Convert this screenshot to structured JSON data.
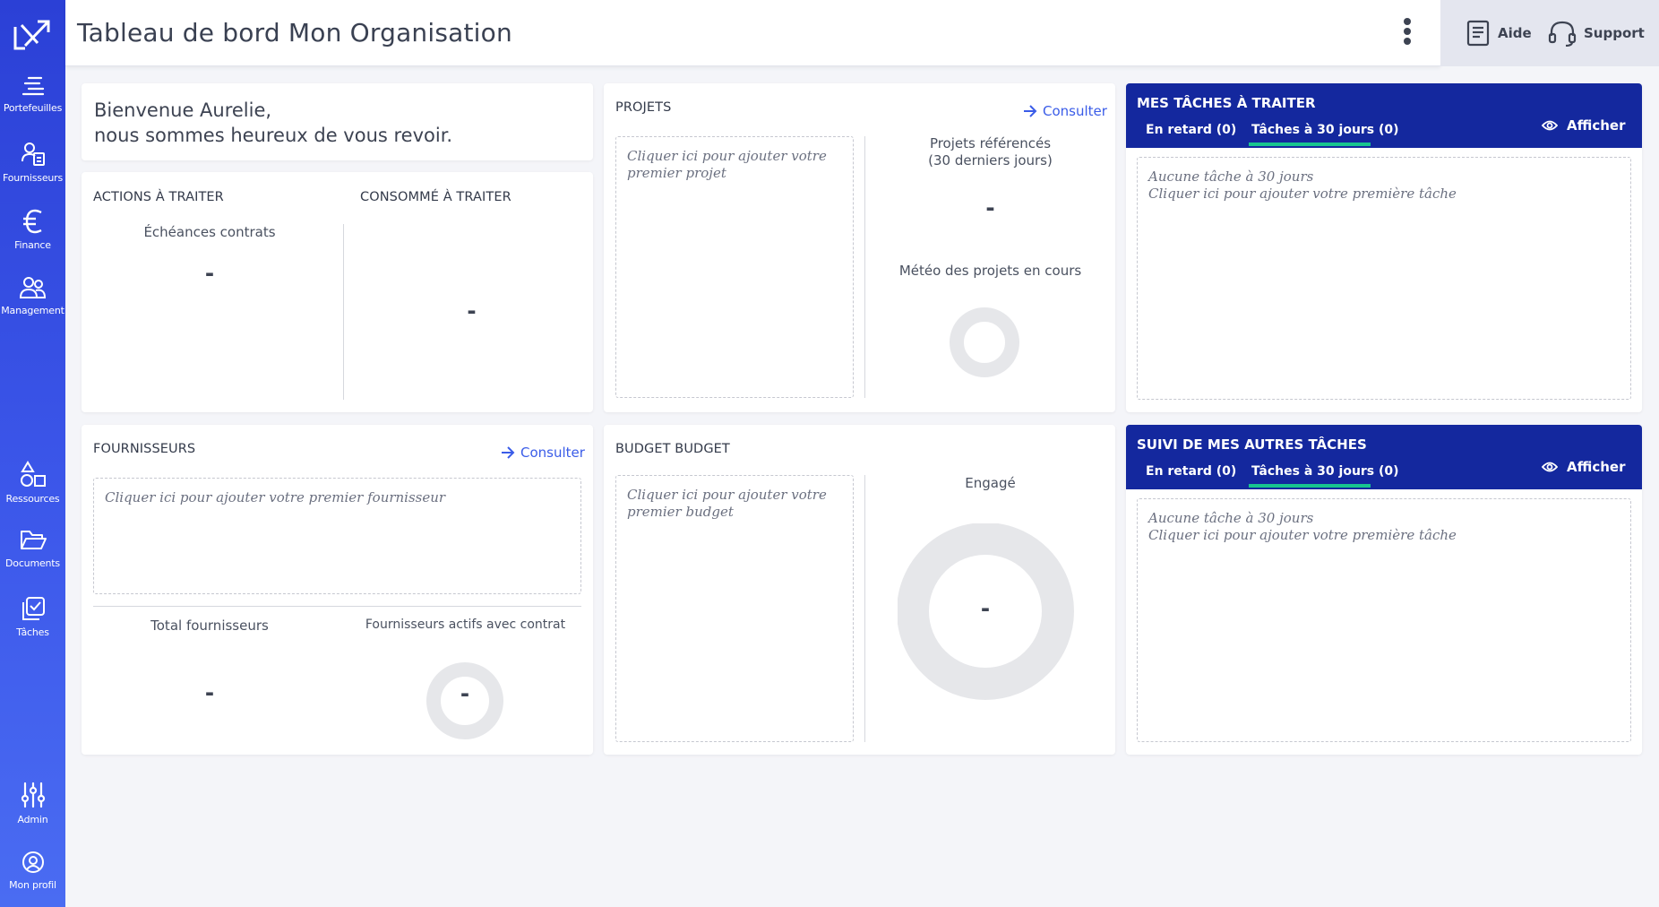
{
  "header": {
    "title": "Tableau de bord Mon Organisation",
    "help_label": "Aide",
    "support_label": "Support"
  },
  "sidebar": {
    "items": [
      {
        "label": "Portefeuilles",
        "icon": "portfolio-icon"
      },
      {
        "label": "Fournisseurs",
        "icon": "suppliers-icon"
      },
      {
        "label": "Finance",
        "icon": "euro-icon"
      },
      {
        "label": "Management",
        "icon": "people-icon"
      },
      {
        "label": "Ressources",
        "icon": "resources-icon"
      },
      {
        "label": "Documents",
        "icon": "folder-icon"
      },
      {
        "label": "Tâches",
        "icon": "tasks-icon"
      },
      {
        "label": "Admin",
        "icon": "sliders-icon"
      },
      {
        "label": "Mon profil",
        "icon": "profile-icon"
      }
    ]
  },
  "welcome": {
    "line1": "Bienvenue Aurelie,",
    "line2": "nous sommes heureux de vous revoir."
  },
  "actions": {
    "title": "ACTIONS À TRAITER",
    "echeances_label": "Échéances contrats",
    "echeances_value": "-",
    "consumed_title": "CONSOMMÉ À TRAITER",
    "consumed_value": "-"
  },
  "projets": {
    "title": "PROJETS",
    "consult": "Consulter",
    "placeholder": "Cliquer ici pour ajouter votre premier projet",
    "referenced_label": "Projets référencés\n(30 derniers jours)",
    "referenced_value": "-",
    "meteo_label": "Météo des projets en cours"
  },
  "fournisseurs": {
    "title": "FOURNISSEURS",
    "consult": "Consulter",
    "placeholder": "Cliquer ici pour ajouter votre premier fournisseur",
    "total_label": "Total fournisseurs",
    "total_value": "-",
    "active_label": "Fournisseurs actifs avec contrat",
    "active_value": "-"
  },
  "budget": {
    "title": "BUDGET BUDGET",
    "placeholder": "Cliquer ici pour ajouter votre premier budget",
    "engaged_label": "Engagé",
    "engaged_value": "-"
  },
  "my_tasks": {
    "title": "MES TÂCHES À TRAITER",
    "tab_late": "En retard (0)",
    "tab_30": "Tâches à 30 jours (0)",
    "show": "Afficher",
    "empty_line1": "Aucune tâche à 30 jours",
    "empty_line2": "Cliquer ici pour ajouter votre première tâche"
  },
  "other_tasks": {
    "title": "SUIVI DE MES AUTRES TÂCHES",
    "tab_late": "En retard (0)",
    "tab_30": "Tâches à 30 jours (0)",
    "show": "Afficher",
    "empty_line1": "Aucune tâche à 30 jours",
    "empty_line2": "Cliquer ici pour ajouter votre première tâche"
  },
  "colors": {
    "sidebar_top": "#2b40d6",
    "task_header": "#14289e",
    "tab_accent": "#18c58f",
    "link": "#3a5ce8"
  }
}
